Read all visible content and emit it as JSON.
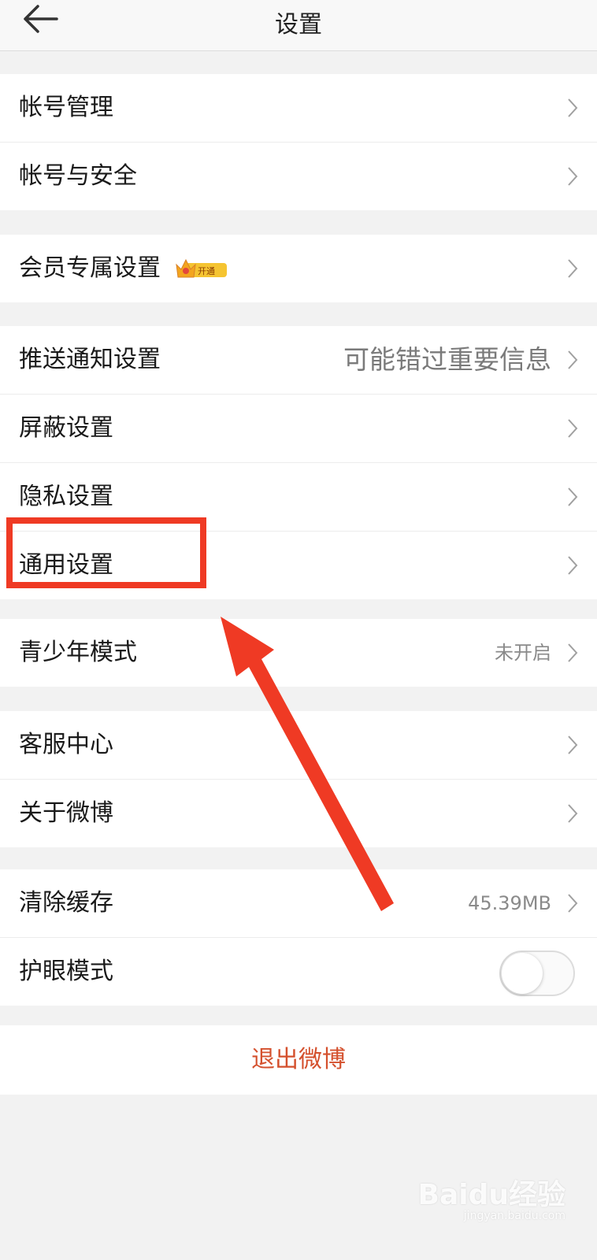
{
  "header": {
    "title": "设置"
  },
  "groups": {
    "account": {
      "items": [
        {
          "label": "帐号管理"
        },
        {
          "label": "帐号与安全"
        }
      ]
    },
    "vip": {
      "items": [
        {
          "label": "会员专属设置",
          "badge": "开通"
        }
      ]
    },
    "settings": {
      "items": [
        {
          "label": "推送通知设置",
          "value": "可能错过重要信息"
        },
        {
          "label": "屏蔽设置"
        },
        {
          "label": "隐私设置"
        },
        {
          "label": "通用设置"
        }
      ]
    },
    "teen": {
      "items": [
        {
          "label": "青少年模式",
          "value": "未开启"
        }
      ]
    },
    "help": {
      "items": [
        {
          "label": "客服中心"
        },
        {
          "label": "关于微博"
        }
      ]
    },
    "misc": {
      "items": [
        {
          "label": "清除缓存",
          "value": "45.39MB"
        },
        {
          "label": "护眼模式",
          "toggle_on": false
        }
      ]
    }
  },
  "logout": {
    "label": "退出微博"
  },
  "watermark": {
    "brand": "Baidu经验",
    "url": "jingyan.baidu.com"
  },
  "colors": {
    "accent_red": "#ef3a24",
    "logout_text": "#d4502d",
    "badge_gold": "#f5c431"
  },
  "icons": {
    "back": "back-arrow-icon",
    "chevron": "chevron-right-icon",
    "crown": "crown-icon"
  }
}
